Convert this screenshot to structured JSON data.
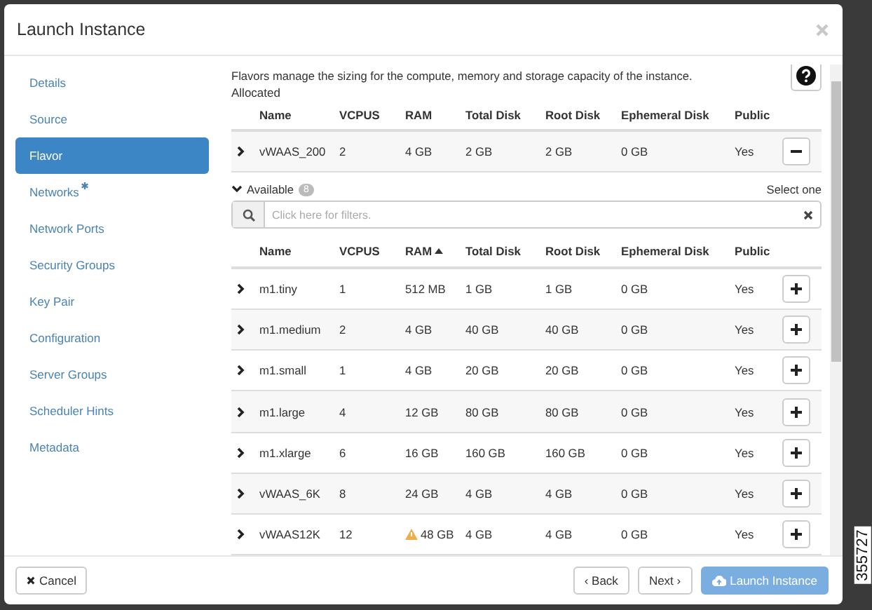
{
  "window": {
    "title": "Launch Instance"
  },
  "sidebar": {
    "items": [
      {
        "label": "Details",
        "selected": false,
        "required": false
      },
      {
        "label": "Source",
        "selected": false,
        "required": false
      },
      {
        "label": "Flavor",
        "selected": true,
        "required": false
      },
      {
        "label": "Networks",
        "selected": false,
        "required": true
      },
      {
        "label": "Network Ports",
        "selected": false,
        "required": false
      },
      {
        "label": "Security Groups",
        "selected": false,
        "required": false
      },
      {
        "label": "Key Pair",
        "selected": false,
        "required": false
      },
      {
        "label": "Configuration",
        "selected": false,
        "required": false
      },
      {
        "label": "Server Groups",
        "selected": false,
        "required": false
      },
      {
        "label": "Scheduler Hints",
        "selected": false,
        "required": false
      },
      {
        "label": "Metadata",
        "selected": false,
        "required": false
      }
    ]
  },
  "description": "Flavors manage the sizing for the compute, memory and storage capacity of the instance.",
  "allocated": {
    "heading": "Allocated",
    "columns": [
      {
        "label": "Name",
        "sorted": false
      },
      {
        "label": "VCPUS",
        "sorted": false
      },
      {
        "label": "RAM",
        "sorted": false
      },
      {
        "label": "Total Disk",
        "sorted": false
      },
      {
        "label": "Root Disk",
        "sorted": false
      },
      {
        "label": "Ephemeral Disk",
        "sorted": false
      },
      {
        "label": "Public",
        "sorted": false
      }
    ],
    "rows": [
      {
        "name": "vWAAS_200",
        "vcpus": "2",
        "ram": "4 GB",
        "warning": false,
        "total_disk": "2 GB",
        "root_disk": "2 GB",
        "ephemeral_disk": "0 GB",
        "public": "Yes",
        "kind": "remove"
      }
    ]
  },
  "available": {
    "heading": "Available",
    "count": "8",
    "select_hint": "Select one",
    "filter": {
      "placeholder": "Click here for filters."
    },
    "columns": [
      {
        "label": "Name",
        "sorted": false
      },
      {
        "label": "VCPUS",
        "sorted": false
      },
      {
        "label": "RAM",
        "sorted": true
      },
      {
        "label": "Total Disk",
        "sorted": false
      },
      {
        "label": "Root Disk",
        "sorted": false
      },
      {
        "label": "Ephemeral Disk",
        "sorted": false
      },
      {
        "label": "Public",
        "sorted": false
      }
    ],
    "rows": [
      {
        "name": "m1.tiny",
        "vcpus": "1",
        "ram": "512 MB",
        "warning": false,
        "total_disk": "1 GB",
        "root_disk": "1 GB",
        "ephemeral_disk": "0 GB",
        "public": "Yes",
        "kind": "add"
      },
      {
        "name": "m1.medium",
        "vcpus": "2",
        "ram": "4 GB",
        "warning": false,
        "total_disk": "40 GB",
        "root_disk": "40 GB",
        "ephemeral_disk": "0 GB",
        "public": "Yes",
        "kind": "add"
      },
      {
        "name": "m1.small",
        "vcpus": "1",
        "ram": "4 GB",
        "warning": false,
        "total_disk": "20 GB",
        "root_disk": "20 GB",
        "ephemeral_disk": "0 GB",
        "public": "Yes",
        "kind": "add"
      },
      {
        "name": "m1.large",
        "vcpus": "4",
        "ram": "12 GB",
        "warning": false,
        "total_disk": "80 GB",
        "root_disk": "80 GB",
        "ephemeral_disk": "0 GB",
        "public": "Yes",
        "kind": "add"
      },
      {
        "name": "m1.xlarge",
        "vcpus": "6",
        "ram": "16 GB",
        "warning": false,
        "total_disk": "160 GB",
        "root_disk": "160 GB",
        "ephemeral_disk": "0 GB",
        "public": "Yes",
        "kind": "add"
      },
      {
        "name": "vWAAS_6K",
        "vcpus": "8",
        "ram": "24 GB",
        "warning": false,
        "total_disk": "4 GB",
        "root_disk": "4 GB",
        "ephemeral_disk": "0 GB",
        "public": "Yes",
        "kind": "add"
      },
      {
        "name": "vWAAS12K",
        "vcpus": "12",
        "ram": "48 GB",
        "warning": true,
        "total_disk": "4 GB",
        "root_disk": "4 GB",
        "ephemeral_disk": "0 GB",
        "public": "Yes",
        "kind": "add"
      }
    ]
  },
  "footer": {
    "cancel": "Cancel",
    "back": "‹ Back",
    "next": "Next ›",
    "launch": {
      "label": "Launch Instance",
      "disabled": true
    }
  },
  "figure_id": "355727"
}
